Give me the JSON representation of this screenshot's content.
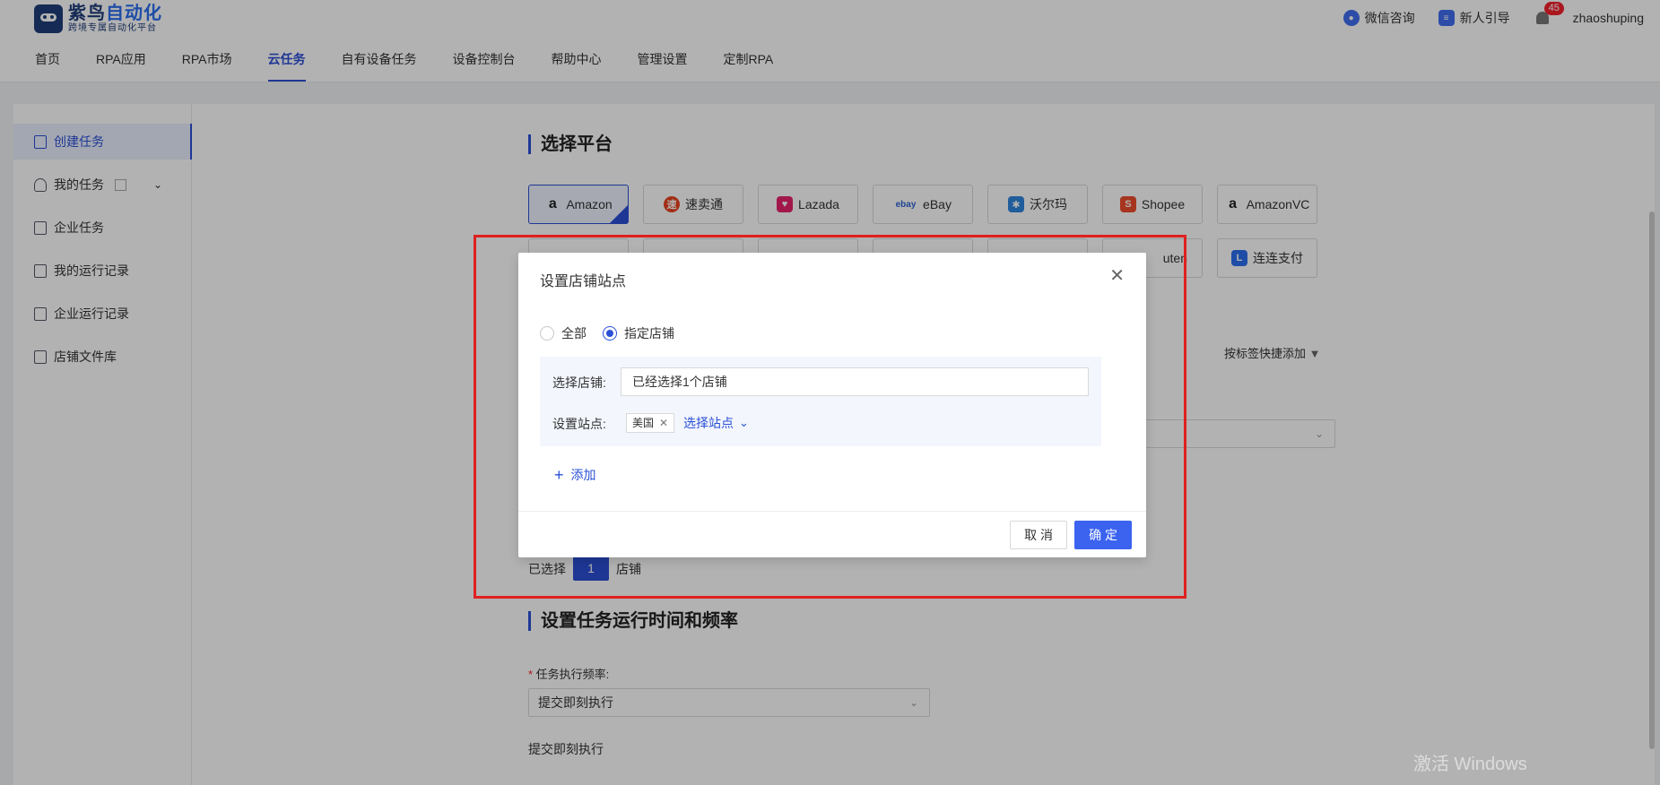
{
  "header": {
    "logo_title_a": "紫鸟",
    "logo_title_b": "自动化",
    "logo_subtitle": "跨境专属自动化平台",
    "links": [
      {
        "label": "微信咨询",
        "icon": "wechat-icon"
      },
      {
        "label": "新人引导",
        "icon": "guide-icon"
      }
    ],
    "notification_count": "45",
    "username": "zhaoshuping"
  },
  "nav": {
    "items": [
      "首页",
      "RPA应用",
      "RPA市场",
      "云任务",
      "自有设备任务",
      "设备控制台",
      "帮助中心",
      "管理设置",
      "定制RPA"
    ],
    "active": "云任务"
  },
  "sidebar": {
    "items": [
      {
        "label": "创建任务",
        "icon": "create-task-icon",
        "active": true
      },
      {
        "label": "我的任务",
        "icon": "user-icon"
      },
      {
        "label": "企业任务",
        "icon": "enterprise-task-icon"
      },
      {
        "label": "我的运行记录",
        "icon": "record-icon"
      },
      {
        "label": "企业运行记录",
        "icon": "enterprise-record-icon"
      },
      {
        "label": "店铺文件库",
        "icon": "store-icon"
      }
    ]
  },
  "main": {
    "section_platform": "选择平台",
    "platforms_row1": [
      "Amazon",
      "速卖通",
      "Lazada",
      "eBay",
      "沃尔玛",
      "Shopee",
      "AmazonVC"
    ],
    "platforms_row2_visible": [
      "uten",
      "连连支付"
    ],
    "quick_add": "按标签快捷添加",
    "selected_prefix": "已选择",
    "selected_count": "1",
    "selected_suffix": "店铺",
    "section_schedule": "设置任务运行时间和频率",
    "freq_label": "任务执行频率:",
    "freq_value": "提交即刻执行",
    "freq_desc": "提交即刻执行"
  },
  "modal": {
    "title": "设置店铺站点",
    "radio_all": "全部",
    "radio_specific": "指定店铺",
    "store_label": "选择店铺:",
    "store_value": "已经选择1个店铺",
    "site_label": "设置站点:",
    "site_tag": "美国",
    "select_site": "选择站点",
    "add": "添加",
    "cancel": "取 消",
    "ok": "确 定"
  },
  "watermark": "激活 Windows",
  "colors": {
    "primary": "#2b50d6",
    "button": "#3b63f0",
    "highlight_frame": "#e0201f"
  }
}
